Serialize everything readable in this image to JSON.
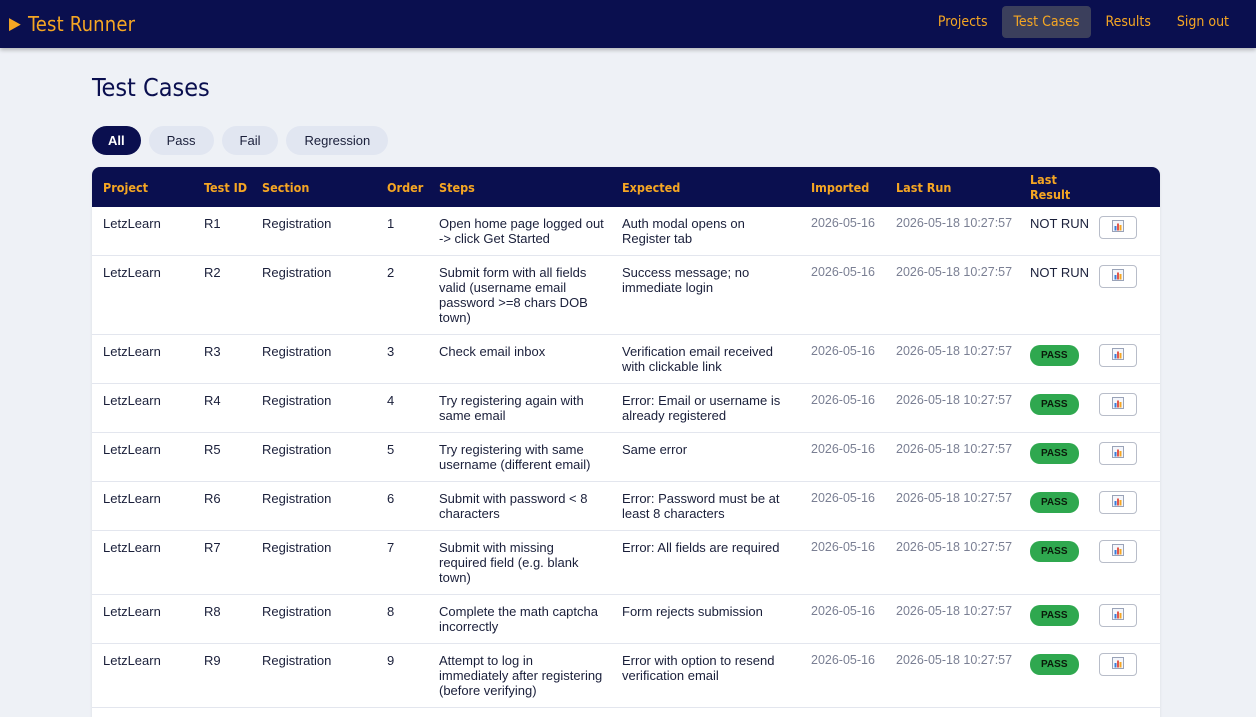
{
  "app": {
    "title": "Test Runner"
  },
  "nav": [
    {
      "label": "Projects",
      "active": false
    },
    {
      "label": "Test Cases",
      "active": true
    },
    {
      "label": "Results",
      "active": false
    },
    {
      "label": "Sign out",
      "active": false
    }
  ],
  "page": {
    "title": "Test Cases"
  },
  "filters": [
    {
      "label": "All",
      "active": true
    },
    {
      "label": "Pass",
      "active": false
    },
    {
      "label": "Fail",
      "active": false
    },
    {
      "label": "Regression",
      "active": false
    }
  ],
  "table": {
    "columns": [
      "Project",
      "Test ID",
      "Section",
      "Order",
      "Steps",
      "Expected",
      "Imported",
      "Last Run",
      "Last Result"
    ],
    "rows": [
      {
        "project": "LetzLearn",
        "test_id": "R1",
        "section": "Registration",
        "order": "1",
        "steps": "Open home page logged out -> click Get Started",
        "expected": "Auth modal opens on Register tab",
        "imported": "2026-05-16",
        "last_run": "2026-05-18 10:27:57",
        "last_result": "NOT RUN",
        "result_type": "text"
      },
      {
        "project": "LetzLearn",
        "test_id": "R2",
        "section": "Registration",
        "order": "2",
        "steps": "Submit form with all fields valid (username email password >=8 chars DOB town)",
        "expected": "Success message; no immediate login",
        "imported": "2026-05-16",
        "last_run": "2026-05-18 10:27:57",
        "last_result": "NOT RUN",
        "result_type": "text"
      },
      {
        "project": "LetzLearn",
        "test_id": "R3",
        "section": "Registration",
        "order": "3",
        "steps": "Check email inbox",
        "expected": "Verification email received with clickable link",
        "imported": "2026-05-16",
        "last_run": "2026-05-18 10:27:57",
        "last_result": "PASS",
        "result_type": "badge"
      },
      {
        "project": "LetzLearn",
        "test_id": "R4",
        "section": "Registration",
        "order": "4",
        "steps": "Try registering again with same email",
        "expected": "Error: Email or username is already registered",
        "imported": "2026-05-16",
        "last_run": "2026-05-18 10:27:57",
        "last_result": "PASS",
        "result_type": "badge"
      },
      {
        "project": "LetzLearn",
        "test_id": "R5",
        "section": "Registration",
        "order": "5",
        "steps": "Try registering with same username (different email)",
        "expected": "Same error",
        "imported": "2026-05-16",
        "last_run": "2026-05-18 10:27:57",
        "last_result": "PASS",
        "result_type": "badge"
      },
      {
        "project": "LetzLearn",
        "test_id": "R6",
        "section": "Registration",
        "order": "6",
        "steps": "Submit with password < 8 characters",
        "expected": "Error: Password must be at least 8 characters",
        "imported": "2026-05-16",
        "last_run": "2026-05-18 10:27:57",
        "last_result": "PASS",
        "result_type": "badge"
      },
      {
        "project": "LetzLearn",
        "test_id": "R7",
        "section": "Registration",
        "order": "7",
        "steps": "Submit with missing required field (e.g. blank town)",
        "expected": "Error: All fields are required",
        "imported": "2026-05-16",
        "last_run": "2026-05-18 10:27:57",
        "last_result": "PASS",
        "result_type": "badge"
      },
      {
        "project": "LetzLearn",
        "test_id": "R8",
        "section": "Registration",
        "order": "8",
        "steps": "Complete the math captcha incorrectly",
        "expected": "Form rejects submission",
        "imported": "2026-05-16",
        "last_run": "2026-05-18 10:27:57",
        "last_result": "PASS",
        "result_type": "badge"
      },
      {
        "project": "LetzLearn",
        "test_id": "R9",
        "section": "Registration",
        "order": "9",
        "steps": "Attempt to log in immediately after registering (before verifying)",
        "expected": "Error with option to resend verification email",
        "imported": "2026-05-16",
        "last_run": "2026-05-18 10:27:57",
        "last_result": "PASS",
        "result_type": "badge"
      }
    ]
  },
  "icons": {
    "brand": "play-icon",
    "row_action": "bar-chart-icon"
  },
  "colors": {
    "navy": "#0a0f4f",
    "accent": "#f5a623",
    "pass": "#2fa84f",
    "background": "#eef1f6"
  }
}
